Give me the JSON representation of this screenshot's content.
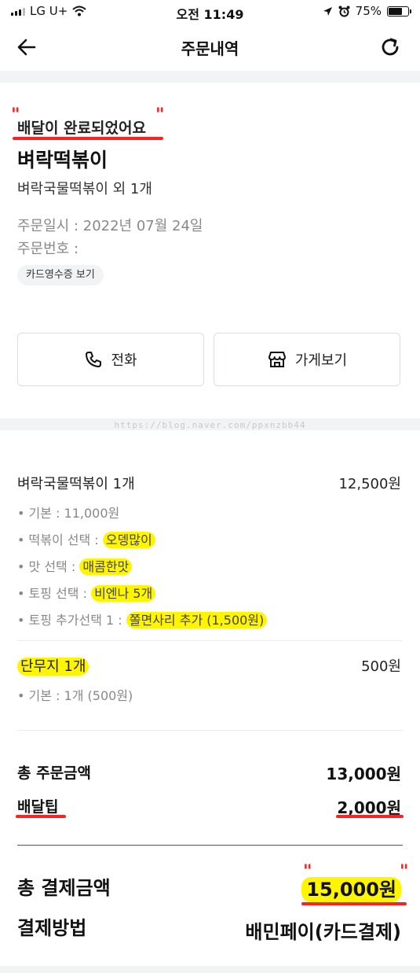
{
  "status_bar": {
    "carrier": "LG U+",
    "time": "오전 11:49",
    "battery": "75%",
    "battery_level": 0.75
  },
  "nav": {
    "title": "주문내역",
    "back_icon": "arrow-left-icon",
    "refresh_icon": "refresh-icon"
  },
  "order": {
    "status": "배달이 완료되었어요",
    "shop_name": "벼락떡볶이",
    "menu_summary": "벼락국물떡볶이 외 1개",
    "order_date": "주문일시 : 2022년 07월 24일",
    "order_number": "주문번호 :",
    "receipt_label": "카드영수증 보기"
  },
  "actions": {
    "call_label": "전화",
    "store_label": "가게보기"
  },
  "watermark": "https://blog.naver.com/ppxnzbb44",
  "items": [
    {
      "name": "벼락국물떡볶이 1개",
      "price": "12,500원",
      "options": [
        {
          "label": "기본 : 11,000원",
          "value": ""
        },
        {
          "label": "떡볶이 선택 : ",
          "value": "오뎅많이"
        },
        {
          "label": "맛 선택 : ",
          "value": "매콤한맛"
        },
        {
          "label": "토핑 선택 : ",
          "value": "비엔나 5개"
        },
        {
          "label": "토핑 추가선택 1 : ",
          "value": "쫄면사리 추가 (1,500원)"
        }
      ]
    },
    {
      "name": "단무지 1개",
      "price": "500원",
      "options": [
        {
          "label": "기본 : 1개 (500원)",
          "value": ""
        }
      ]
    }
  ],
  "summary": {
    "order_total_label": "총 주문금액",
    "order_total_value": "13,000원",
    "delivery_tip_label": "배달팁",
    "delivery_tip_value": "2,000원",
    "payment_total_label": "총 결제금액",
    "payment_total_value": "15,000원",
    "payment_method_label": "결제방법",
    "payment_method_value": "배민페이(카드결제)"
  },
  "colors": {
    "highlight_yellow": "#fff500",
    "annotation_red": "#ff2020",
    "section_gap": "#f2f3f5"
  }
}
